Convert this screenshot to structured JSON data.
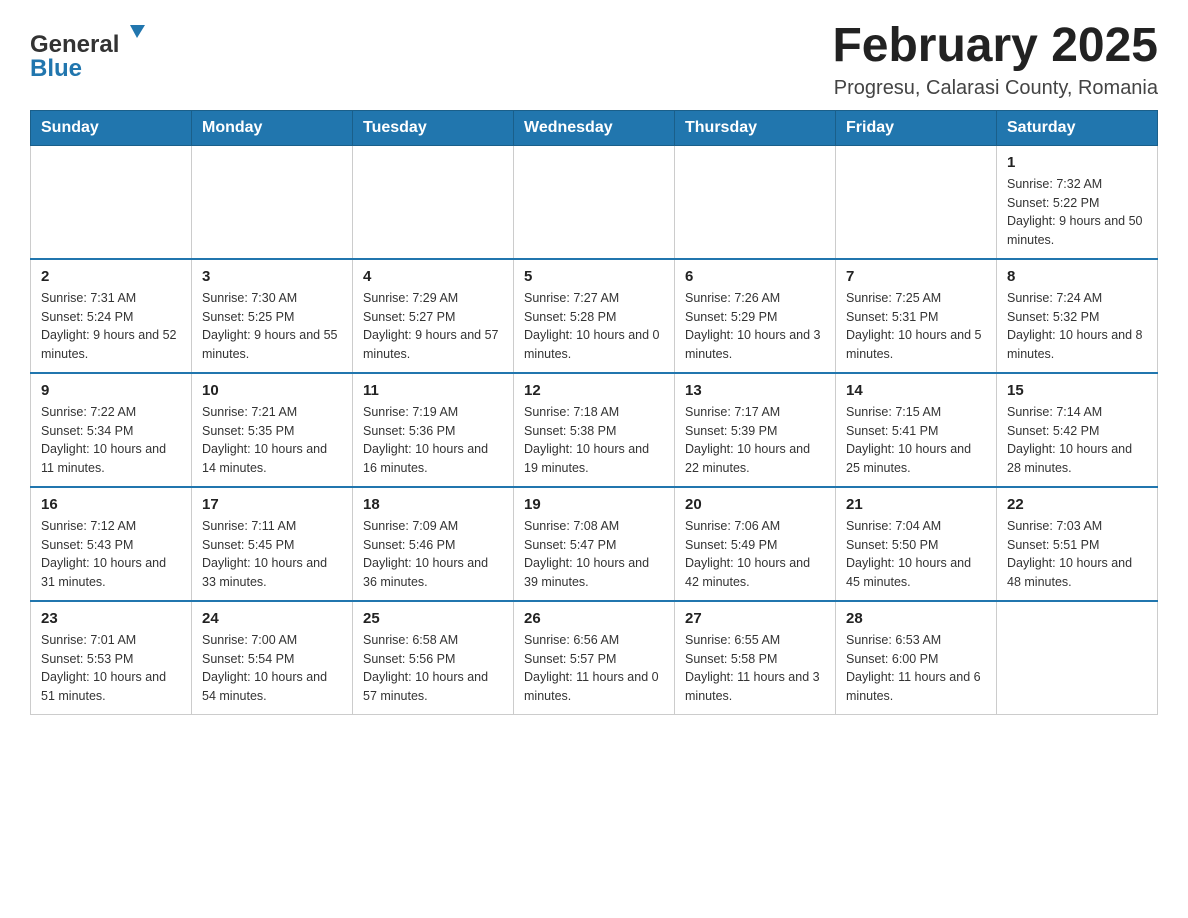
{
  "header": {
    "logo_general": "General",
    "logo_blue": "Blue",
    "month_title": "February 2025",
    "location": "Progresu, Calarasi County, Romania"
  },
  "weekdays": [
    "Sunday",
    "Monday",
    "Tuesday",
    "Wednesday",
    "Thursday",
    "Friday",
    "Saturday"
  ],
  "weeks": [
    [
      {
        "day": "",
        "info": ""
      },
      {
        "day": "",
        "info": ""
      },
      {
        "day": "",
        "info": ""
      },
      {
        "day": "",
        "info": ""
      },
      {
        "day": "",
        "info": ""
      },
      {
        "day": "",
        "info": ""
      },
      {
        "day": "1",
        "info": "Sunrise: 7:32 AM\nSunset: 5:22 PM\nDaylight: 9 hours and 50 minutes."
      }
    ],
    [
      {
        "day": "2",
        "info": "Sunrise: 7:31 AM\nSunset: 5:24 PM\nDaylight: 9 hours and 52 minutes."
      },
      {
        "day": "3",
        "info": "Sunrise: 7:30 AM\nSunset: 5:25 PM\nDaylight: 9 hours and 55 minutes."
      },
      {
        "day": "4",
        "info": "Sunrise: 7:29 AM\nSunset: 5:27 PM\nDaylight: 9 hours and 57 minutes."
      },
      {
        "day": "5",
        "info": "Sunrise: 7:27 AM\nSunset: 5:28 PM\nDaylight: 10 hours and 0 minutes."
      },
      {
        "day": "6",
        "info": "Sunrise: 7:26 AM\nSunset: 5:29 PM\nDaylight: 10 hours and 3 minutes."
      },
      {
        "day": "7",
        "info": "Sunrise: 7:25 AM\nSunset: 5:31 PM\nDaylight: 10 hours and 5 minutes."
      },
      {
        "day": "8",
        "info": "Sunrise: 7:24 AM\nSunset: 5:32 PM\nDaylight: 10 hours and 8 minutes."
      }
    ],
    [
      {
        "day": "9",
        "info": "Sunrise: 7:22 AM\nSunset: 5:34 PM\nDaylight: 10 hours and 11 minutes."
      },
      {
        "day": "10",
        "info": "Sunrise: 7:21 AM\nSunset: 5:35 PM\nDaylight: 10 hours and 14 minutes."
      },
      {
        "day": "11",
        "info": "Sunrise: 7:19 AM\nSunset: 5:36 PM\nDaylight: 10 hours and 16 minutes."
      },
      {
        "day": "12",
        "info": "Sunrise: 7:18 AM\nSunset: 5:38 PM\nDaylight: 10 hours and 19 minutes."
      },
      {
        "day": "13",
        "info": "Sunrise: 7:17 AM\nSunset: 5:39 PM\nDaylight: 10 hours and 22 minutes."
      },
      {
        "day": "14",
        "info": "Sunrise: 7:15 AM\nSunset: 5:41 PM\nDaylight: 10 hours and 25 minutes."
      },
      {
        "day": "15",
        "info": "Sunrise: 7:14 AM\nSunset: 5:42 PM\nDaylight: 10 hours and 28 minutes."
      }
    ],
    [
      {
        "day": "16",
        "info": "Sunrise: 7:12 AM\nSunset: 5:43 PM\nDaylight: 10 hours and 31 minutes."
      },
      {
        "day": "17",
        "info": "Sunrise: 7:11 AM\nSunset: 5:45 PM\nDaylight: 10 hours and 33 minutes."
      },
      {
        "day": "18",
        "info": "Sunrise: 7:09 AM\nSunset: 5:46 PM\nDaylight: 10 hours and 36 minutes."
      },
      {
        "day": "19",
        "info": "Sunrise: 7:08 AM\nSunset: 5:47 PM\nDaylight: 10 hours and 39 minutes."
      },
      {
        "day": "20",
        "info": "Sunrise: 7:06 AM\nSunset: 5:49 PM\nDaylight: 10 hours and 42 minutes."
      },
      {
        "day": "21",
        "info": "Sunrise: 7:04 AM\nSunset: 5:50 PM\nDaylight: 10 hours and 45 minutes."
      },
      {
        "day": "22",
        "info": "Sunrise: 7:03 AM\nSunset: 5:51 PM\nDaylight: 10 hours and 48 minutes."
      }
    ],
    [
      {
        "day": "23",
        "info": "Sunrise: 7:01 AM\nSunset: 5:53 PM\nDaylight: 10 hours and 51 minutes."
      },
      {
        "day": "24",
        "info": "Sunrise: 7:00 AM\nSunset: 5:54 PM\nDaylight: 10 hours and 54 minutes."
      },
      {
        "day": "25",
        "info": "Sunrise: 6:58 AM\nSunset: 5:56 PM\nDaylight: 10 hours and 57 minutes."
      },
      {
        "day": "26",
        "info": "Sunrise: 6:56 AM\nSunset: 5:57 PM\nDaylight: 11 hours and 0 minutes."
      },
      {
        "day": "27",
        "info": "Sunrise: 6:55 AM\nSunset: 5:58 PM\nDaylight: 11 hours and 3 minutes."
      },
      {
        "day": "28",
        "info": "Sunrise: 6:53 AM\nSunset: 6:00 PM\nDaylight: 11 hours and 6 minutes."
      },
      {
        "day": "",
        "info": ""
      }
    ]
  ]
}
